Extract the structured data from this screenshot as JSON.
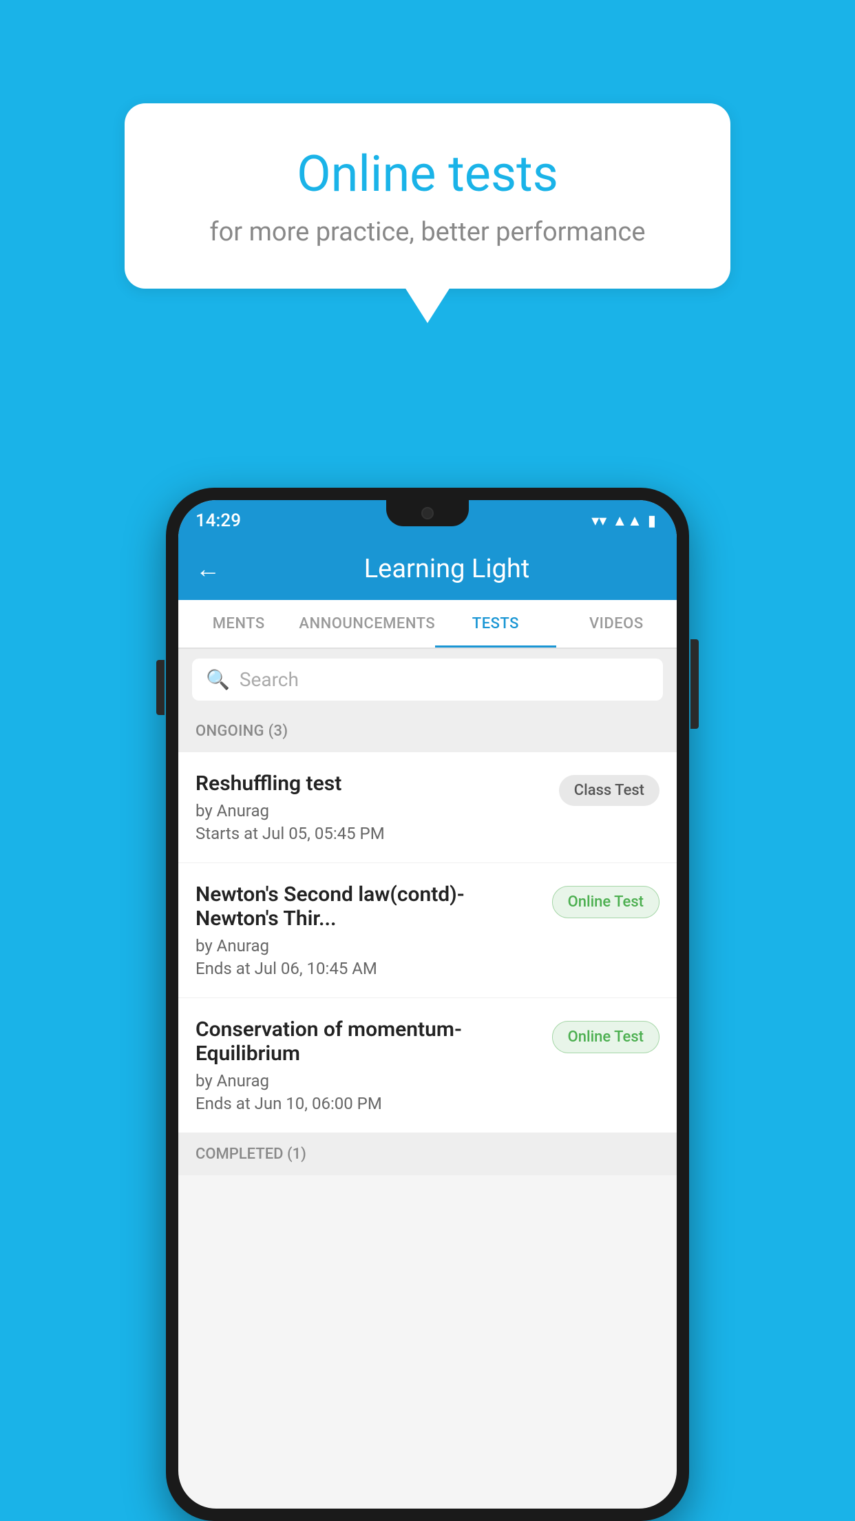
{
  "background_color": "#1ab3e8",
  "speech_bubble": {
    "title": "Online tests",
    "subtitle": "for more practice, better performance"
  },
  "phone": {
    "status_bar": {
      "time": "14:29",
      "icons": [
        "wifi",
        "signal",
        "battery"
      ]
    },
    "app_bar": {
      "title": "Learning Light",
      "back_label": "←"
    },
    "tabs": [
      {
        "label": "MENTS",
        "active": false
      },
      {
        "label": "ANNOUNCEMENTS",
        "active": false
      },
      {
        "label": "TESTS",
        "active": true
      },
      {
        "label": "VIDEOS",
        "active": false
      }
    ],
    "search": {
      "placeholder": "Search"
    },
    "ongoing_section": {
      "label": "ONGOING (3)"
    },
    "test_items": [
      {
        "name": "Reshuffling test",
        "author": "by Anurag",
        "date": "Starts at  Jul 05, 05:45 PM",
        "badge": "Class Test",
        "badge_type": "class"
      },
      {
        "name": "Newton's Second law(contd)-Newton's Thir...",
        "author": "by Anurag",
        "date": "Ends at  Jul 06, 10:45 AM",
        "badge": "Online Test",
        "badge_type": "online"
      },
      {
        "name": "Conservation of momentum-Equilibrium",
        "author": "by Anurag",
        "date": "Ends at  Jun 10, 06:00 PM",
        "badge": "Online Test",
        "badge_type": "online"
      }
    ],
    "completed_section": {
      "label": "COMPLETED (1)"
    }
  }
}
